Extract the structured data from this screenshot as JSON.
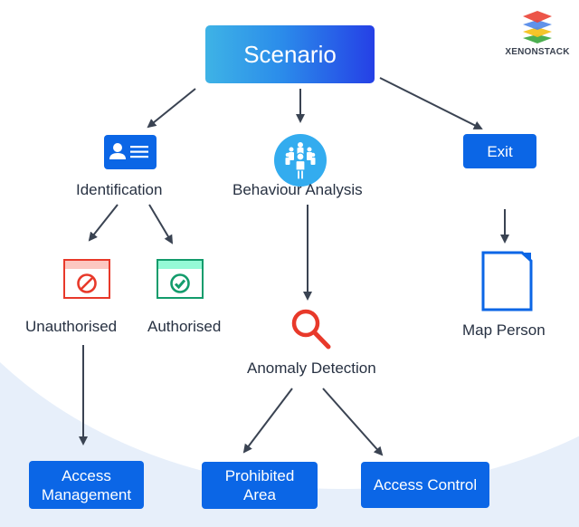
{
  "brand": {
    "name": "XENONSTACK"
  },
  "root": {
    "label": "Scenario"
  },
  "branches": {
    "identification": {
      "label": "Identification",
      "icon": "id-card-icon"
    },
    "behaviour": {
      "label": "Behaviour Analysis",
      "icon": "people-group-icon"
    },
    "exit": {
      "label": "Exit"
    }
  },
  "identification_children": {
    "unauthorised": {
      "label": "Unauthorised",
      "icon": "blocked-window-icon"
    },
    "authorised": {
      "label": "Authorised",
      "icon": "approved-window-icon"
    }
  },
  "anomaly": {
    "label": "Anomaly Detection",
    "icon": "magnifier-icon"
  },
  "map_person": {
    "label": "Map Person",
    "icon": "document-icon"
  },
  "leaves": {
    "access_management": {
      "line1": "Access",
      "line2": "Management"
    },
    "prohibited_area": {
      "line1": "Prohibited",
      "line2": "Area"
    },
    "access_control": {
      "label": "Access Control"
    }
  },
  "colors": {
    "primary_blue": "#0b66e6",
    "arrow": "#3a4352",
    "red": "#e8392a",
    "green": "#139c6c",
    "sky": "#33acef"
  }
}
